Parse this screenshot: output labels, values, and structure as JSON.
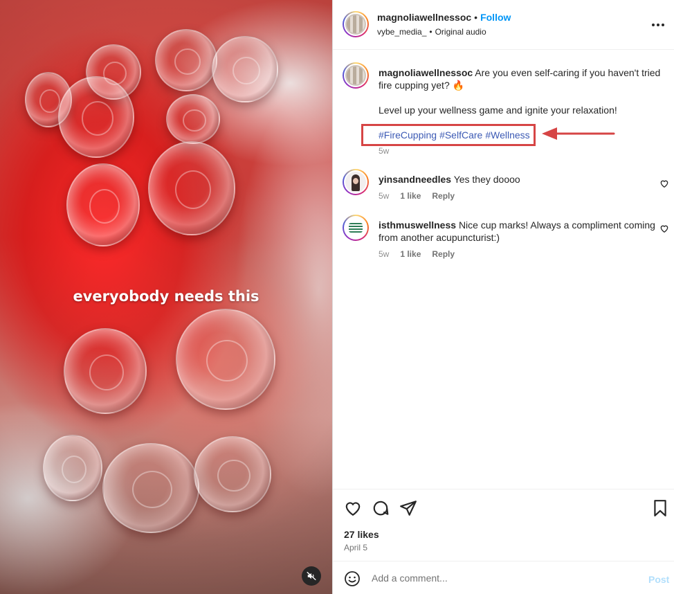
{
  "media": {
    "overlay_text": "everyobody needs this",
    "mute_icon": "speaker-muted-icon"
  },
  "header": {
    "username": "magnoliawellnessoc",
    "separator": "•",
    "follow_label": "Follow",
    "audio_user": "vybe_media_",
    "audio_separator": "•",
    "audio_label": "Original audio",
    "more_icon": "more-options-icon"
  },
  "caption": {
    "username": "magnoliawellnessoc",
    "text_line1": "Are you even self-caring if you haven't tried",
    "text_line2": "fire cupping yet? 🔥",
    "text_line3": "Level up your wellness game and ignite your relaxation!",
    "hashtags": [
      "#FireCupping",
      "#SelfCare",
      "#Wellness"
    ],
    "time": "5w",
    "highlight_color": "#d64545"
  },
  "comments": [
    {
      "username": "yinsandneedles",
      "text": "Yes they doooo",
      "time": "5w",
      "likes": "1 like",
      "reply_label": "Reply"
    },
    {
      "username": "isthmuswellness",
      "text_line1": "Nice cup marks! Always a compliment coming",
      "text_line2": "from another acupuncturist:)",
      "time": "5w",
      "likes": "1 like",
      "reply_label": "Reply"
    }
  ],
  "actions": {
    "likes": "27 likes",
    "date": "April 5"
  },
  "comment_box": {
    "placeholder": "Add a comment...",
    "post_label": "Post"
  },
  "colors": {
    "accent": "#0095f6",
    "hashtag": "#3c5ab4",
    "annotation": "#d64545"
  }
}
